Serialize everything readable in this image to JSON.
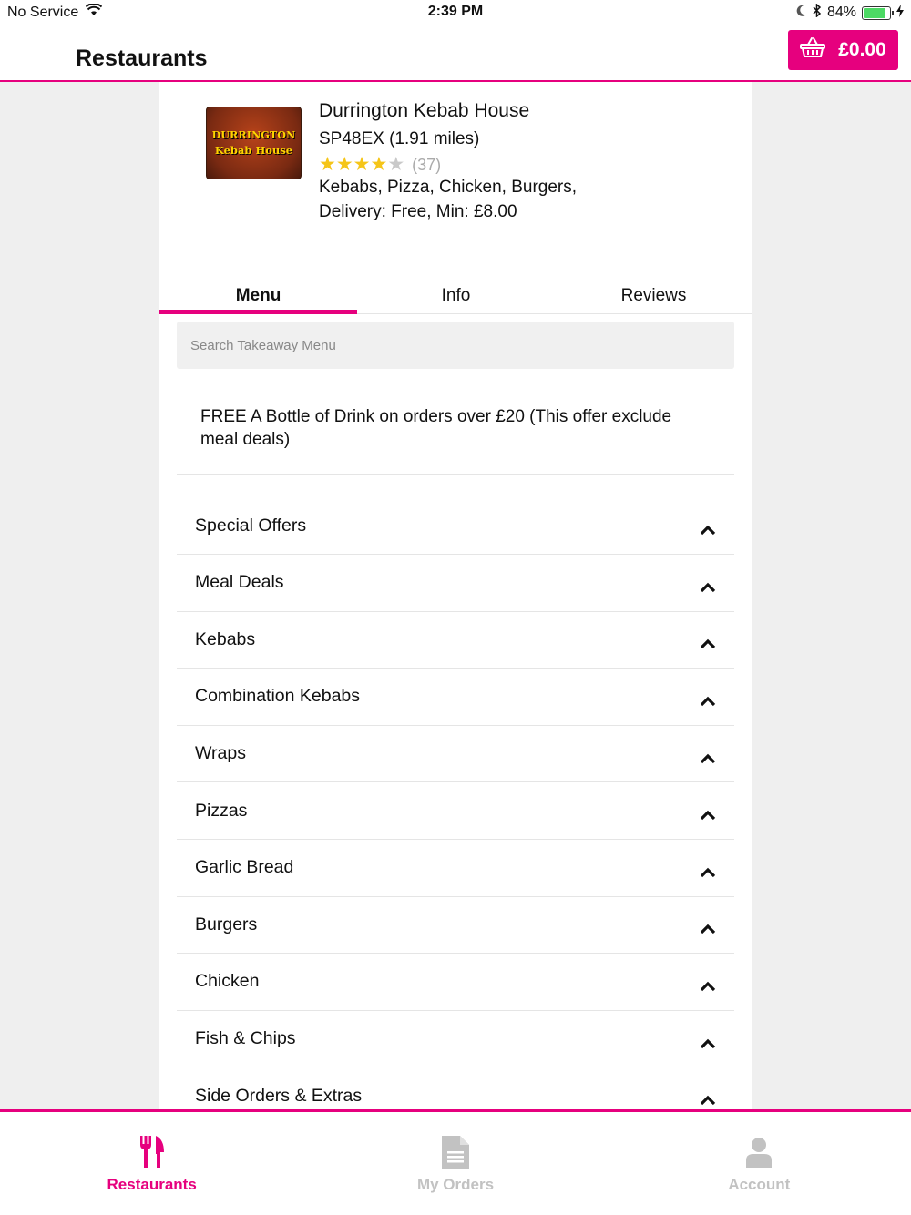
{
  "status_bar": {
    "carrier": "No Service",
    "time": "2:39 PM",
    "battery_percent": "84%"
  },
  "header": {
    "title": "Restaurants",
    "cart_total": "£0.00"
  },
  "restaurant": {
    "logo_line1": "DURRINGTON",
    "logo_line2": "Kebab House",
    "name": "Durrington Kebab House",
    "postcode_distance": "SP48EX (1.91 miles)",
    "rating_stars": 4,
    "rating_max": 5,
    "review_count": "(37)",
    "cuisine": "Kebabs, Pizza, Chicken, Burgers,",
    "delivery": "Delivery: Free, Min: £8.00"
  },
  "tabs": [
    {
      "label": "Menu",
      "active": true
    },
    {
      "label": "Info",
      "active": false
    },
    {
      "label": "Reviews",
      "active": false
    }
  ],
  "search": {
    "placeholder": "Search Takeaway Menu",
    "value": ""
  },
  "offer_text": "FREE A Bottle of Drink on orders over £20 (This offer exclude meal deals)",
  "categories": [
    "Special Offers",
    "Meal Deals",
    "Kebabs",
    "Combination Kebabs",
    "Wraps",
    "Pizzas",
    "Garlic Bread",
    "Burgers",
    "Chicken",
    "Fish & Chips",
    "Side Orders & Extras"
  ],
  "bottom_nav": [
    {
      "label": "Restaurants",
      "icon": "fork-knife-icon",
      "active": true
    },
    {
      "label": "My Orders",
      "icon": "document-icon",
      "active": false
    },
    {
      "label": "Account",
      "icon": "person-icon",
      "active": false
    }
  ],
  "colors": {
    "accent": "#e6007e",
    "star": "#f5c518",
    "battery": "#4cd964",
    "inactive_nav": "#c2c2c2"
  }
}
